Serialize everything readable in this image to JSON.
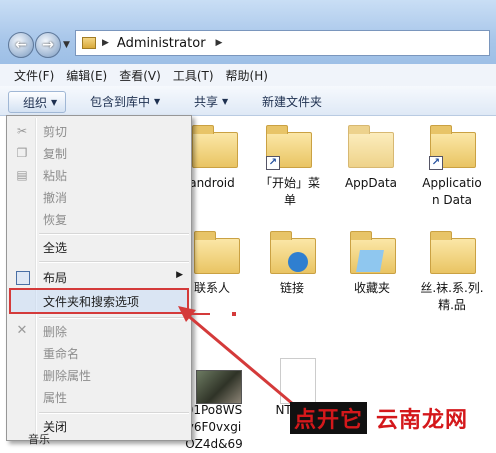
{
  "address": {
    "path": "Administrator"
  },
  "menubar": {
    "items": [
      "文件(F)",
      "编辑(E)",
      "查看(V)",
      "工具(T)",
      "帮助(H)"
    ]
  },
  "commandbar": {
    "organize": "组织",
    "include_library": "包含到库中",
    "share": "共享",
    "new_folder": "新建文件夹"
  },
  "dropdown": {
    "items": [
      {
        "label": "剪切",
        "enabled": false,
        "icon": "scissors-icon"
      },
      {
        "label": "复制",
        "enabled": false,
        "icon": "copy-icon"
      },
      {
        "label": "粘贴",
        "enabled": false,
        "icon": "paste-icon"
      },
      {
        "label": "撤消",
        "enabled": false
      },
      {
        "label": "恢复",
        "enabled": false
      },
      {
        "label": "全选",
        "enabled": true
      },
      {
        "label": "布局",
        "enabled": true,
        "icon": "layout-icon",
        "submenu": true
      },
      {
        "label": "文件夹和搜索选项",
        "enabled": true,
        "highlighted": true
      },
      {
        "label": "删除",
        "enabled": false,
        "icon": "delete-icon"
      },
      {
        "label": "重命名",
        "enabled": false
      },
      {
        "label": "删除属性",
        "enabled": false
      },
      {
        "label": "属性",
        "enabled": false
      },
      {
        "label": "关闭",
        "enabled": true
      }
    ]
  },
  "files": {
    "row1": [
      {
        "label": "android"
      },
      {
        "label1": "「开始」菜",
        "label2": "单"
      },
      {
        "label": "AppData"
      },
      {
        "label1": "Applicatio",
        "label2": "n Data"
      }
    ],
    "row2": [
      {
        "label": "联系人"
      },
      {
        "label": "链接"
      },
      {
        "label": "收藏夹"
      },
      {
        "label1": "丝.袜.系.列.",
        "label2": "精.品"
      }
    ],
    "row3": [
      {
        "label1": "01Po8WS",
        "label2": "y6F0vxgi",
        "label3": "OZ4d&69"
      },
      {
        "label": "NTU"
      }
    ]
  },
  "watermark": {
    "dark": "点开它",
    "light": "云南龙网"
  },
  "bottom_partial": "音乐",
  "colors": {
    "annotation_red": "#d43a3a",
    "folder_yellow": "#f3d584"
  }
}
